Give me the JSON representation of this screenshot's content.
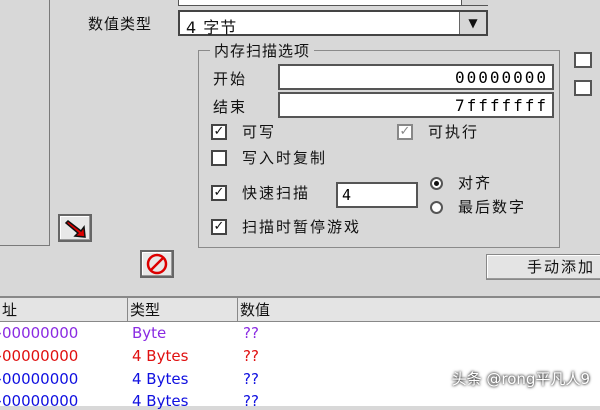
{
  "form": {
    "value_type_label": "数值类型",
    "value_type_selected": "4 字节"
  },
  "scan_options": {
    "title": "内存扫描选项",
    "start_label": "开始",
    "start_value": "00000000",
    "end_label": "结束",
    "end_value": "7fffffff",
    "writable_label": "可写",
    "writable_checked": true,
    "executable_label": "可执行",
    "executable_checked": true,
    "copy_on_write_label": "写入时复制",
    "copy_on_write_checked": false,
    "fast_scan_label": "快速扫描",
    "fast_scan_checked": true,
    "fast_scan_value": "4",
    "align_label": "对齐",
    "last_digits_label": "最后数字",
    "pause_label": "扫描时暂停游戏",
    "pause_checked": true
  },
  "buttons": {
    "manual_add": "手动添加"
  },
  "address_list": {
    "headers": [
      "址",
      "类型",
      "数值"
    ],
    "rows": [
      {
        "address": "›00000000",
        "type": "Byte",
        "value": "??",
        "color": "#8a2be2"
      },
      {
        "address": "›00000000",
        "type": "4 Bytes",
        "value": "??",
        "color": "#e01010"
      },
      {
        "address": "›00000000",
        "type": "4 Bytes",
        "value": "??",
        "color": "#1010e0"
      },
      {
        "address": "›00000000",
        "type": "4 Bytes",
        "value": "??",
        "color": "#1010e0"
      }
    ]
  },
  "watermark": "头条 @rong平凡人9",
  "icons": {
    "arrow_button": "red-arrow-icon",
    "clear_button": "no-entry-icon"
  }
}
